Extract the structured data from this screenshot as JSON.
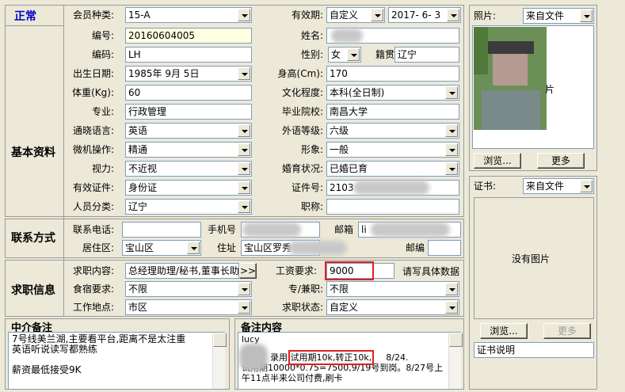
{
  "status": "正常",
  "member_type": {
    "label": "会员种类:",
    "value": "15-A"
  },
  "validity": {
    "label": "有效期:",
    "value": "自定义",
    "date": "2017- 6- 3"
  },
  "photo": {
    "label": "照片:",
    "source": "来自文件",
    "placeholder_fragment": "片",
    "browse": "浏览...",
    "more": "更多"
  },
  "certificate": {
    "label": "证书:",
    "source": "来自文件",
    "no_image": "没有图片",
    "browse": "浏览...",
    "more": "更多",
    "desc_label": "证书说明"
  },
  "basic": {
    "section": "基本资料",
    "id_label": "编号:",
    "id_value": "20160604005",
    "name_label": "姓名:",
    "code_label": "编码:",
    "code_value": "LH",
    "gender_label": "性别:",
    "gender_value": "女",
    "origin_label": "籍贯",
    "origin_value": "辽宁",
    "birth_label": "出生日期:",
    "birth_value": "1985年 9月 5日",
    "height_label": "身高(Cm):",
    "height_value": "170",
    "weight_label": "体重(Kg):",
    "weight_value": "60",
    "edu_label": "文化程度:",
    "edu_value": "本科(全日制)",
    "major_label": "专业:",
    "major_value": "行政管理",
    "school_label": "毕业院校:",
    "school_value": "南昌大学",
    "lang_label": "通晓语言:",
    "lang_value": "英语",
    "lang_level_label": "外语等级:",
    "lang_level_value": "六级",
    "computer_label": "微机操作:",
    "computer_value": "精通",
    "image_label": "形象:",
    "image_value": "一般",
    "vision_label": "视力:",
    "vision_value": "不近视",
    "marital_label": "婚育状况:",
    "marital_value": "已婚已育",
    "idtype_label": "有效证件:",
    "idtype_value": "身份证",
    "idno_label": "证件号:",
    "idno_value": "2103",
    "category_label": "人员分类:",
    "category_value": "辽宁",
    "title_label": "职称:"
  },
  "contact": {
    "section": "联系方式",
    "phone_label": "联系电话:",
    "mobile_label": "手机号",
    "email_label": "邮箱",
    "email_value": "li",
    "district_label": "居住区:",
    "district_value": "宝山区",
    "address_label": "住址",
    "address_value": "宝山区罗秀",
    "postcode_label": "邮编"
  },
  "job": {
    "section": "求职信息",
    "content_label": "求职内容:",
    "content_value": "总经理助理/秘书,董事长助",
    "more_btn": ">>",
    "salary_label": "工资要求:",
    "salary_value": "9000",
    "salary_hint": "请写具体数据",
    "food_label": "食宿要求:",
    "food_value": "不限",
    "parttime_label": "专/兼职:",
    "parttime_value": "不限",
    "location_label": "工作地点:",
    "location_value": "市区",
    "status_label": "求职状态:",
    "status_value": "自定义"
  },
  "agent_notes": {
    "title": "中介备注",
    "text": "7号线美兰湖,主要看平台,距离不是太注重\n英语听说读写都熟练\n\n薪资最低接受9K"
  },
  "remarks": {
    "title": "备注内容",
    "line1": "lucy",
    "line2_prefix": "录用,",
    "line2_highlight": "试用期10k,转正10k,",
    "line2_suffix": "8/24.",
    "line3": "试用期10000*0.75=7500,9/19号到岗。8/27号上",
    "line4": "午11点半来公司付费,刷卡"
  },
  "colors": {
    "background": "#ece9d8",
    "status_blue": "#0000cc",
    "highlight_red": "#e02020",
    "id_field_bg": "#ffffe1"
  }
}
